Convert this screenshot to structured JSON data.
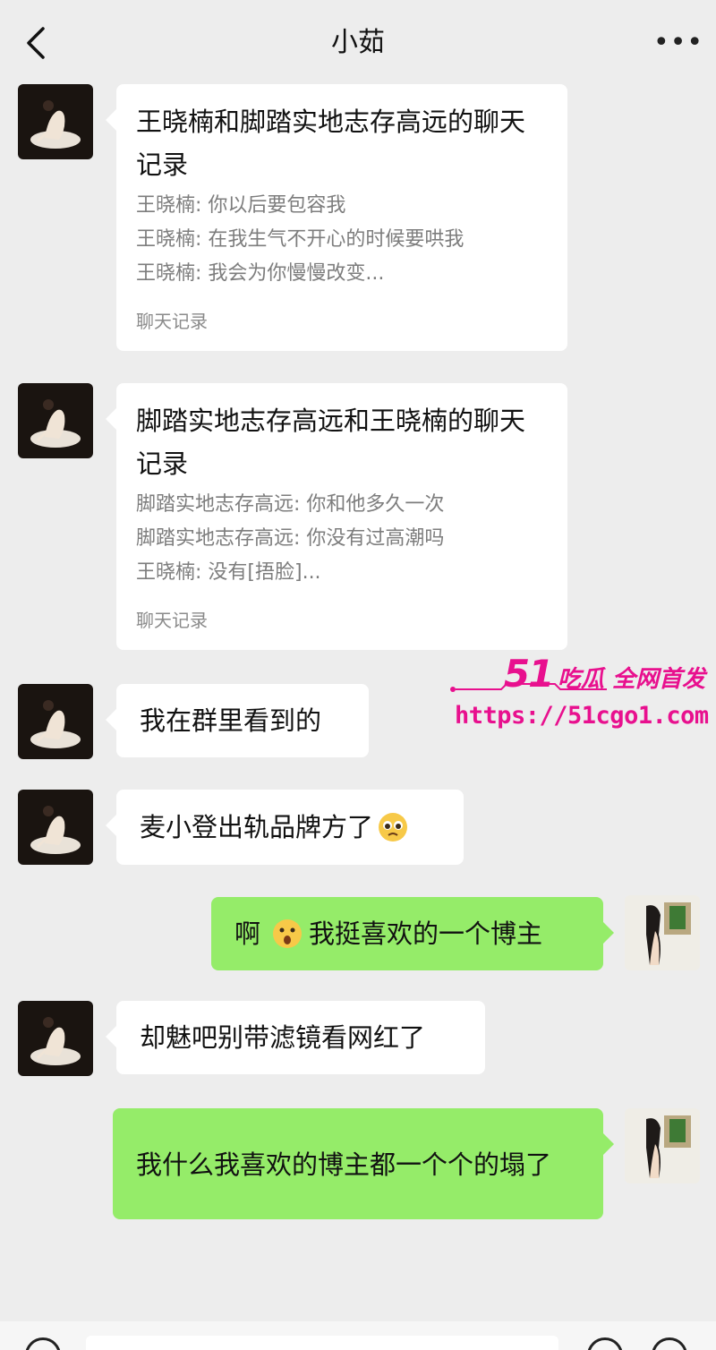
{
  "header": {
    "title": "小茹",
    "back_icon": "chevron-left-icon",
    "more_label": "•••"
  },
  "messages": [
    {
      "type": "chat-record",
      "direction": "in",
      "title": "王晓楠和脚踏实地志存高远的聊天记录",
      "lines": [
        "王晓楠: 你以后要包容我",
        "王晓楠: 在我生气不开心的时候要哄我",
        "王晓楠: 我会为你慢慢改变..."
      ],
      "footer": "聊天记录"
    },
    {
      "type": "chat-record",
      "direction": "in",
      "title": "脚踏实地志存高远和王晓楠的聊天记录",
      "lines": [
        "脚踏实地志存高远: 你和他多久一次",
        "脚踏实地志存高远: 你没有过高潮吗",
        "王晓楠: 没有[捂脸]..."
      ],
      "footer": "聊天记录"
    },
    {
      "type": "text",
      "direction": "in",
      "text": "我在群里看到的"
    },
    {
      "type": "text",
      "direction": "in",
      "text": "麦小登出轨品牌方了",
      "emoji": "pleading-face-emoji"
    },
    {
      "type": "text",
      "direction": "out",
      "text_before": "啊",
      "emoji": "surprised-face-emoji",
      "text_after": "我挺喜欢的一个博主"
    },
    {
      "type": "text",
      "direction": "in",
      "text": "却魅吧别带滤镜看网红了"
    },
    {
      "type": "text",
      "direction": "out",
      "text": "我什么我喜欢的博主都一个个的塌了"
    }
  ],
  "watermark": {
    "number": "51",
    "slogan": "吃瓜 全网首发",
    "url": "https://51cgo1.com"
  },
  "colors": {
    "background": "#ededed",
    "bubble_in": "#ffffff",
    "bubble_out": "#95ec69",
    "watermark": "#e8108e"
  }
}
